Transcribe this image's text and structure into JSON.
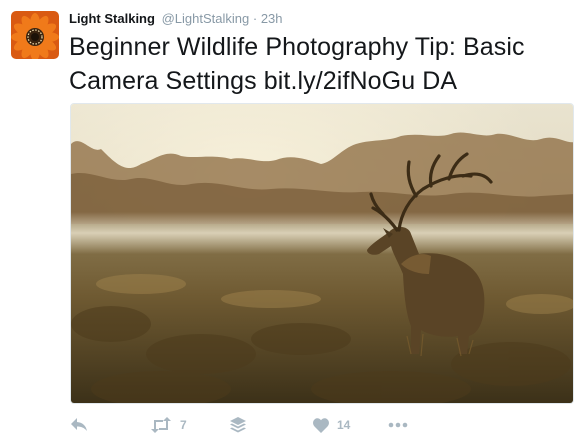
{
  "tweet": {
    "author_name": "Light Stalking",
    "author_handle": "@LightStalking",
    "separator": "·",
    "timestamp": "23h",
    "text": "Beginner Wildlife Photography Tip: Basic Camera Settings bit.ly/2ifNoGu DA",
    "avatar": "orange-gazania-flower",
    "media": "red-deer-stag-in-misty-field-photo"
  },
  "actions": {
    "retweet_count": "7",
    "like_count": "14",
    "icons": [
      "reply-icon",
      "retweet-icon",
      "buffer-icon",
      "heart-icon",
      "more-icon"
    ]
  },
  "colors": {
    "text": "#14171a",
    "muted": "#8899a6",
    "action": "#aab8c2"
  }
}
